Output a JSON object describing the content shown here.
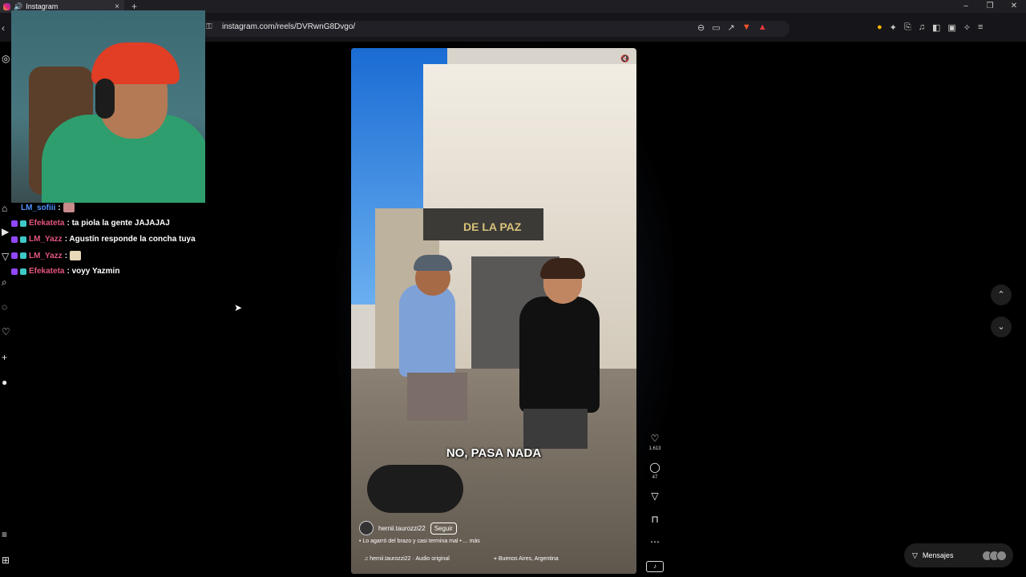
{
  "browser": {
    "tab_title": "Instagram",
    "new_tab": "+",
    "tab_close": "×",
    "url": "instagram.com/reels/DVRwnG8Dvgo/",
    "window_controls": [
      "–",
      "❐",
      "✕"
    ]
  },
  "chat": [
    {
      "user": "LM_sofiii",
      "text": ":",
      "color": "#4f93ff"
    },
    {
      "user": "Efekateta",
      "text": ": ta piola la gente JAJAJAJ",
      "color": "#e2557d"
    },
    {
      "user": "LM_Yazz",
      "text": ": Agustín responde la concha tuya",
      "color": "#e2557d"
    },
    {
      "user": "LM_Yazz",
      "text": ":",
      "color": "#e2557d"
    },
    {
      "user": "Efekateta",
      "text": ": voyy Yazmin",
      "color": "#e2557d"
    }
  ],
  "reel": {
    "store_sign": "DE LA PAZ",
    "caption_overlay": "NO, PASA NADA",
    "username": "hernii.taurozzi22",
    "follow_label": "Seguir",
    "caption": "• Lo agarró del brazo y casi termina mal • ... más",
    "audio": "♫ hernii.taurozzi22 · Audio original",
    "location": "⌖ Buenos Aires, Argentina",
    "likes": "1.613",
    "comments": "47"
  },
  "messages": {
    "label": "Mensajes"
  }
}
